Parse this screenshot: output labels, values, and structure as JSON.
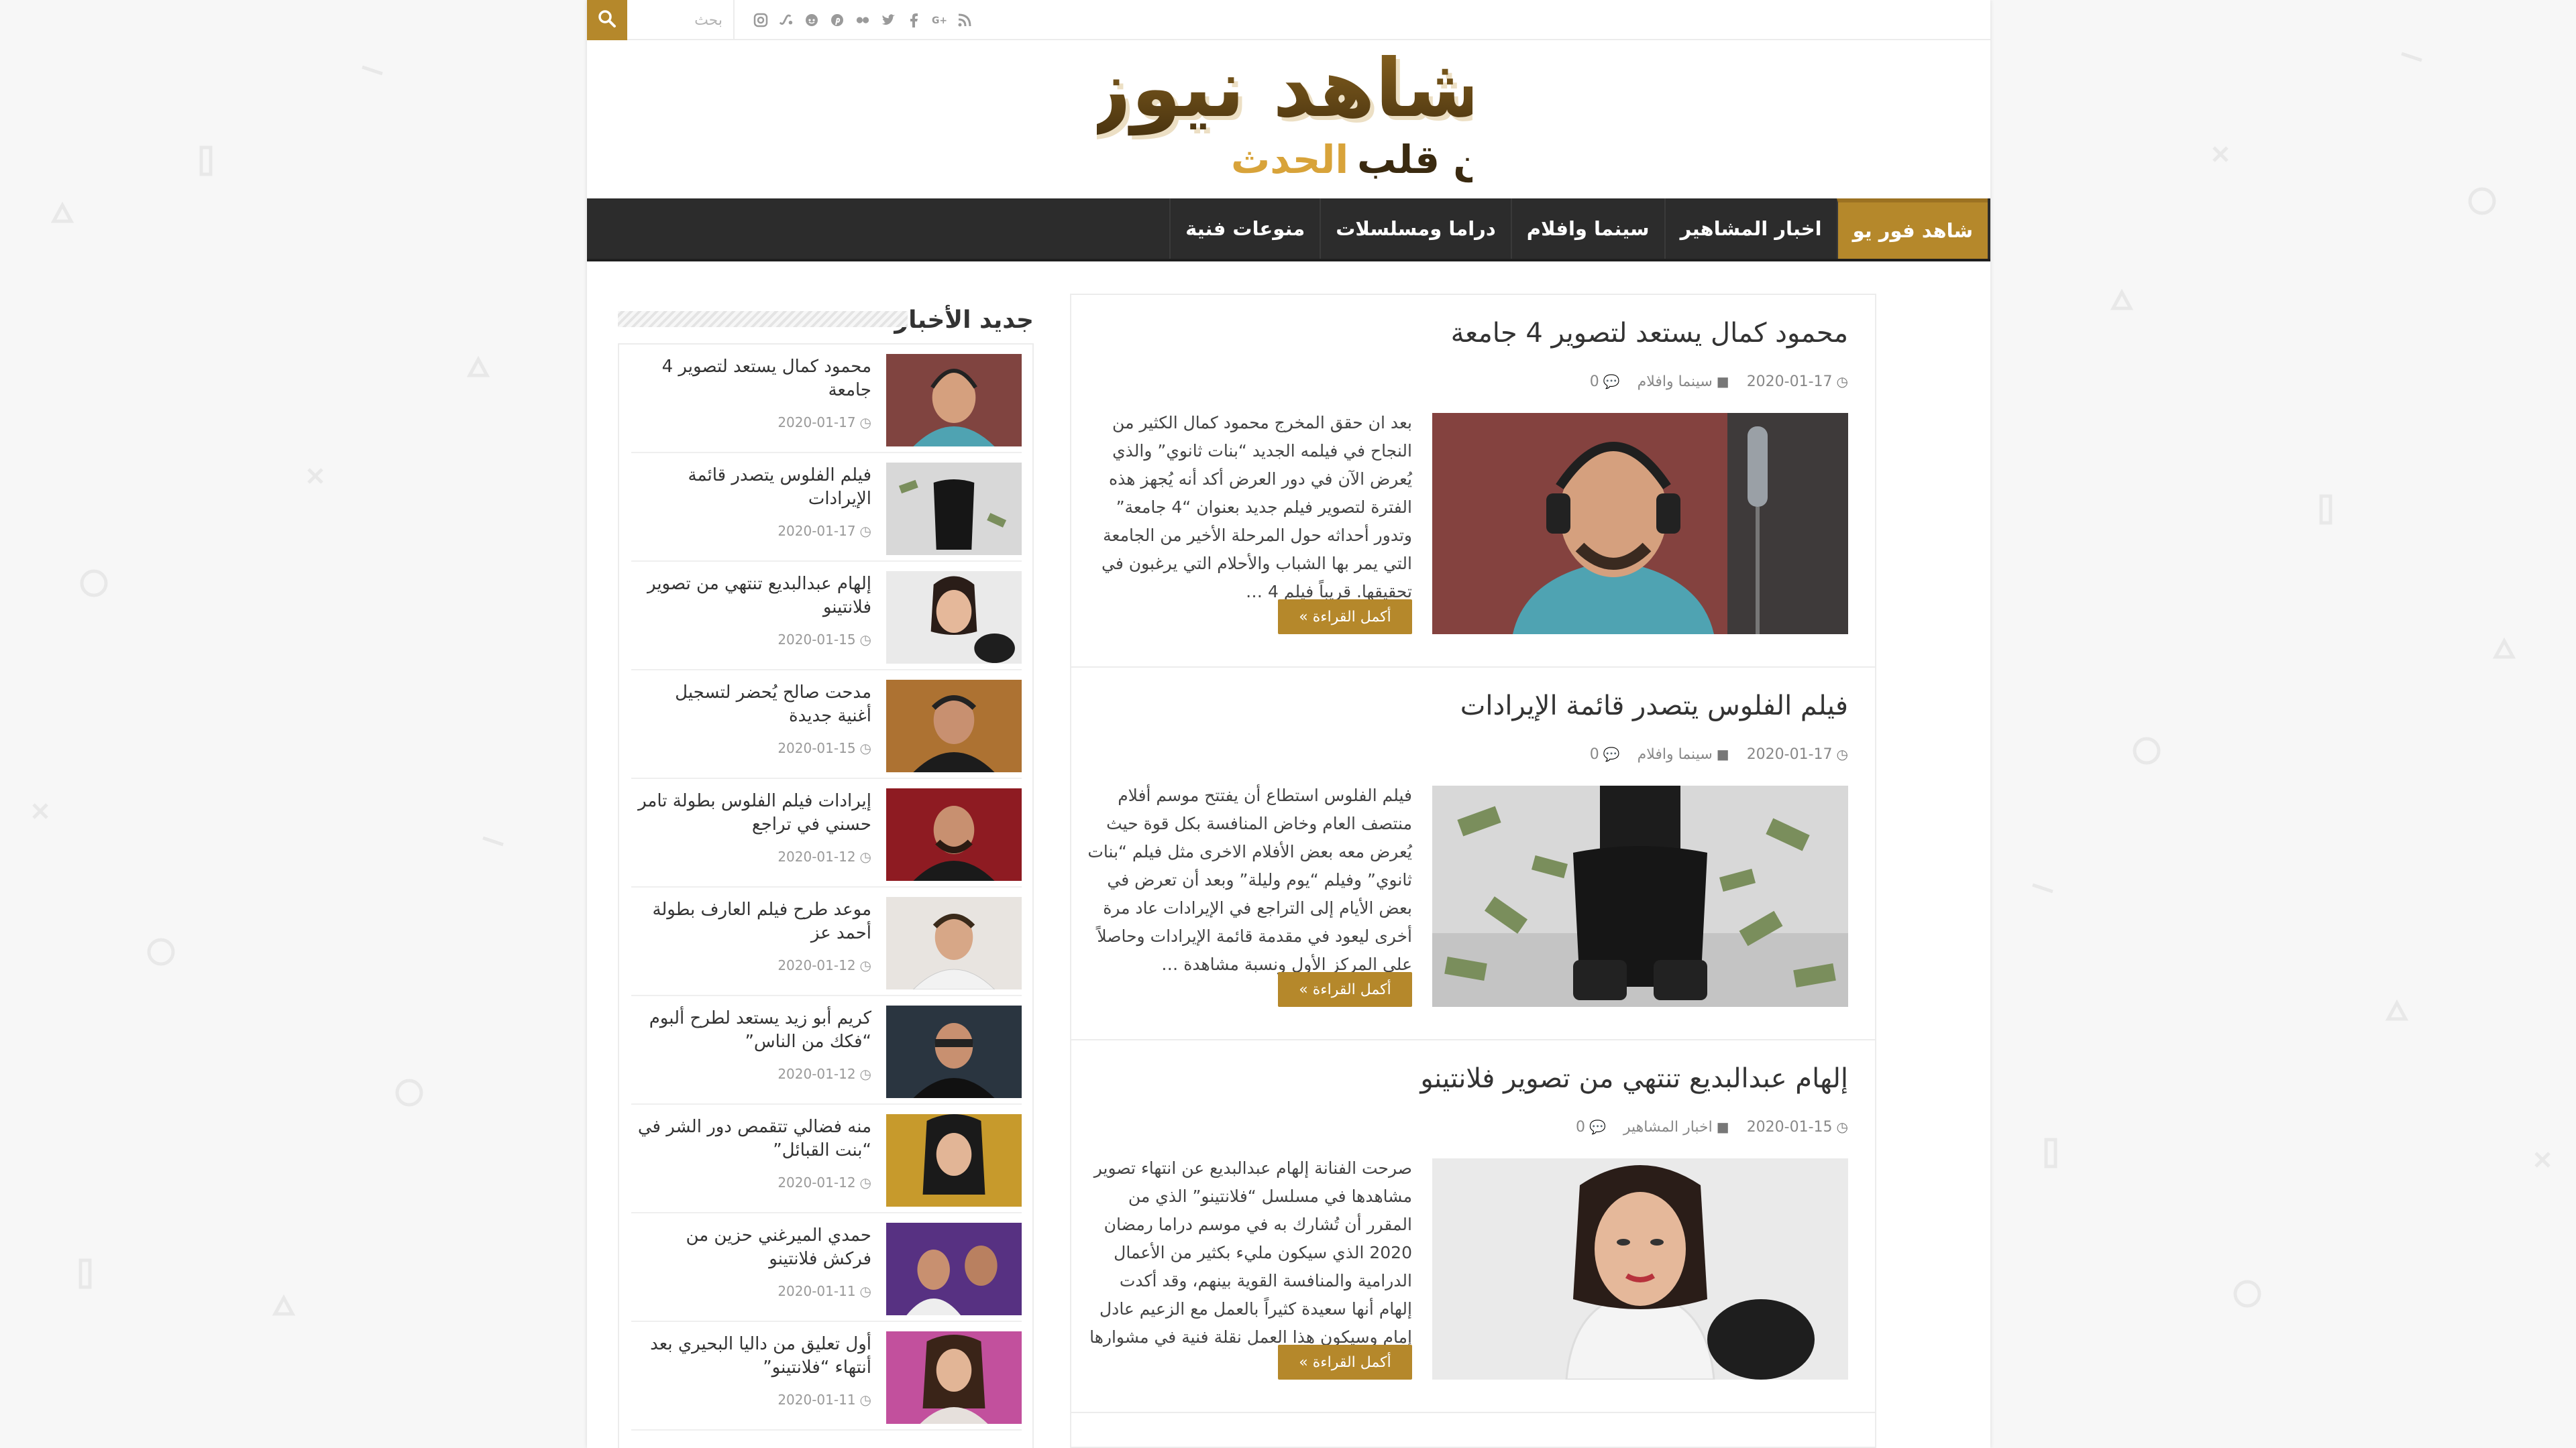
{
  "search": {
    "placeholder": "بحث"
  },
  "social_icons": [
    "rss-icon",
    "google-plus-icon",
    "facebook-icon",
    "twitter-icon",
    "pinterest-icon",
    "flickr-icon",
    "reddit-icon",
    "lastfm-icon",
    "instagram-icon"
  ],
  "logo": {
    "title": "شاهد نيوز",
    "tagline_part1": "من قلب",
    "tagline_part2": "الحدث"
  },
  "nav": {
    "items": [
      {
        "label": "شاهد فور يو",
        "active": true
      },
      {
        "label": "اخبار المشاهير"
      },
      {
        "label": "سينما وافلام"
      },
      {
        "label": "دراما ومسلسلات"
      },
      {
        "label": "منوعات فنية"
      }
    ]
  },
  "posts": [
    {
      "title": "محمود كمال يستعد لتصوير 4 جامعة",
      "date": "2020-01-17",
      "category": "سينما وافلام",
      "comments": "0",
      "excerpt": "بعد ان حقق المخرج محمود كمال الكثير من النجاح في فيلمه الجديد “بنات ثانوي” والذي يُعرض الآن في دور العرض أكد أنه يُجهز هذه الفترة لتصوير فيلم جديد بعنوان “4 جامعة” وتدور أحداثه حول المرحلة الأخير من الجامعة التي يمر بها الشباب والأحلام التي يرغبون في تحقيقها. قريباً فيلم 4 …",
      "more": "أكمل القراءة »"
    },
    {
      "title": "فيلم الفلوس يتصدر قائمة الإيرادات",
      "date": "2020-01-17",
      "category": "سينما وافلام",
      "comments": "0",
      "excerpt": "فيلم الفلوس استطاع أن يفتتح موسم أفلام منتصف العام وخاض المنافسة بكل قوة حيث يُعرض معه بعض الأفلام الاخرى مثل فيلم “بنات ثانوي” وفيلم “يوم وليلة” وبعد أن تعرض في بعض الأيام إلى التراجع في الإيرادات عاد مرة أخرى ليعود في مقدمة قائمة الإيرادات وحاصلاً على المركز الأول ونسبة مشاهدة …",
      "more": "أكمل القراءة »"
    },
    {
      "title": "إلهام عبدالبديع تنتهي من تصوير فلانتينو",
      "date": "2020-01-15",
      "category": "اخبار المشاهير",
      "comments": "0",
      "excerpt": "صرحت الفنانة إلهام عبدالبديع عن انتهاء تصوير مشاهدها في مسلسل “فلانتينو” الذي من المقرر أن تُشارك به في موسم دراما رمضان 2020 الذي سيكون مليء بكثير من الأعمال الدرامية والمنافسة القوية بينهم، وقد أكدت إلهام أنها سعيدة كثيراً بالعمل مع الزعيم عادل إمام وسيكون هذا العمل نقلة فنية في مشوارها …",
      "more": "أكمل القراءة »"
    }
  ],
  "sidebar": {
    "title": "جديد الأخبار",
    "items": [
      {
        "title": "محمود كمال يستعد لتصوير 4 جامعة",
        "date": "2020-01-17"
      },
      {
        "title": "فيلم الفلوس يتصدر قائمة الإيرادات",
        "date": "2020-01-17"
      },
      {
        "title": "إلهام عبدالبديع تنتهي من تصوير فلانتينو",
        "date": "2020-01-15"
      },
      {
        "title": "مدحت صالح يُحضر لتسجيل أغنية جديدة",
        "date": "2020-01-15"
      },
      {
        "title": "إيرادات فيلم الفلوس بطولة تامر حسني في تراجع",
        "date": "2020-01-12"
      },
      {
        "title": "موعد طرح فيلم العارف بطولة أحمد عز",
        "date": "2020-01-12"
      },
      {
        "title": "كريم أبو زيد يستعد لطرح ألبوم “فكك من الناس”",
        "date": "2020-01-12"
      },
      {
        "title": "منه فضالي تتقمص دور الشر في “بنت القبائل”",
        "date": "2020-01-12"
      },
      {
        "title": "حمدي الميرغني حزين من فركش فلانتينو",
        "date": "2020-01-11"
      },
      {
        "title": "أول تعليق من داليا البحيري بعد أنتهاء “فلانتينو”",
        "date": "2020-01-11"
      }
    ]
  },
  "colors": {
    "accent": "#b5882b",
    "nav_bg": "#2c2c2c",
    "page_bg": "#f7f7f7"
  }
}
